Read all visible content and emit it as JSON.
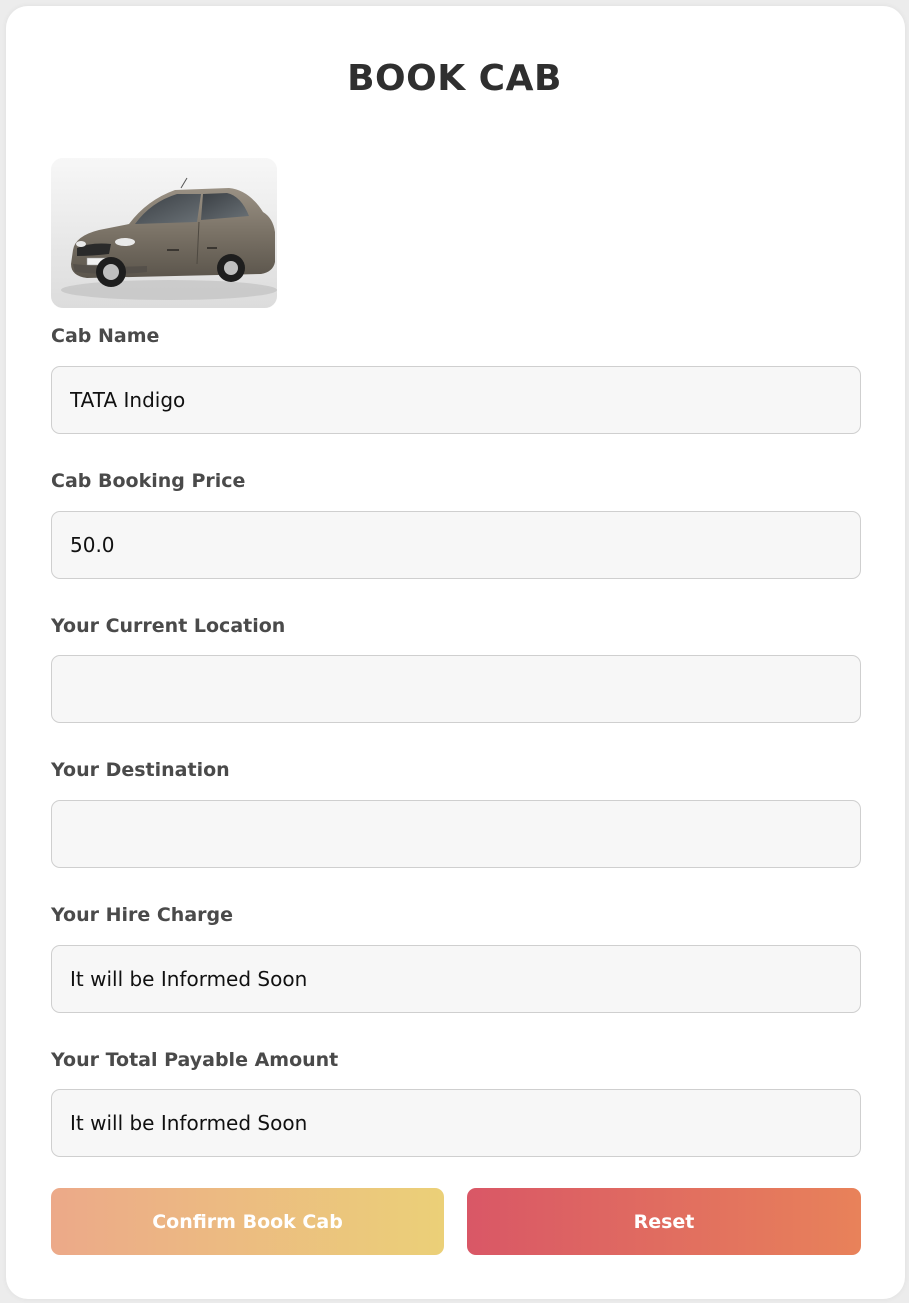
{
  "page": {
    "title": "BOOK CAB"
  },
  "car_image": {
    "icon": "car-photo",
    "body_color": "#7a7266"
  },
  "form": {
    "cab_name": {
      "label": "Cab Name",
      "value": "TATA Indigo"
    },
    "cab_price": {
      "label": "Cab Booking Price",
      "value": "50.0"
    },
    "current_location": {
      "label": "Your Current Location",
      "value": ""
    },
    "destination": {
      "label": "Your Destination",
      "value": ""
    },
    "hire_charge": {
      "label": "Your Hire Charge",
      "value": "It will be Informed Soon"
    },
    "total_amount": {
      "label": "Your Total Payable Amount",
      "value": "It will be Informed Soon"
    }
  },
  "buttons": {
    "confirm_label": "Confirm Book Cab",
    "reset_label": "Reset"
  },
  "colors": {
    "confirm_gradient": [
      "#eca989",
      "#ebd078"
    ],
    "reset_gradient": [
      "#d95766",
      "#e8825a"
    ],
    "label_color": "#4a4a4a",
    "title_color": "#2f2f2f"
  }
}
